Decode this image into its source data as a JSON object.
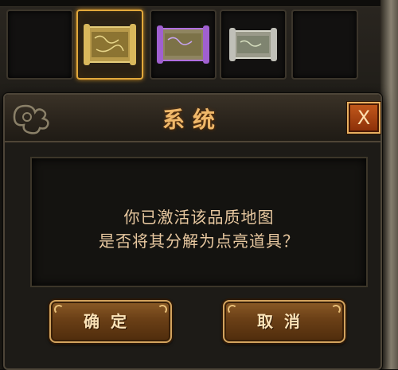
{
  "dialog": {
    "title": "系统",
    "close_label": "X",
    "message_line1": "你已激活该品质地图",
    "message_line2": "是否将其分解为点亮道具？",
    "confirm_label": "确定",
    "cancel_label": "取消"
  },
  "inventory": {
    "items": [
      {
        "icon": "empty-slot"
      },
      {
        "icon": "gold-map-scroll-icon",
        "selected": true
      },
      {
        "icon": "purple-map-scroll-icon"
      },
      {
        "icon": "silver-map-scroll-icon"
      },
      {
        "icon": "empty-slot"
      }
    ]
  },
  "colors": {
    "title": "#f0b86a",
    "message": "#e8c8a0",
    "button_text": "#fbe3b8",
    "selected_border": "#e2a83b",
    "close_button": "#c45a1c"
  }
}
